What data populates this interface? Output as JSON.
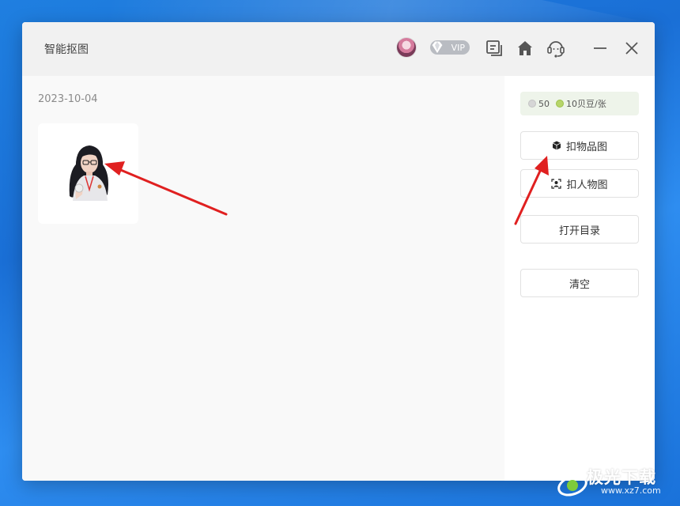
{
  "window": {
    "title": "智能抠图"
  },
  "titlebar": {
    "vip_label": "VIP",
    "icons": [
      "avatar",
      "vip-gem-icon",
      "message-icon",
      "home-icon",
      "headset-icon",
      "minimize-icon",
      "close-icon"
    ]
  },
  "main": {
    "date": "2023-10-04",
    "thumbnail": "cutout-person-image"
  },
  "sidebar": {
    "credits_count": "50",
    "price_text": "10贝豆/张",
    "buttons": {
      "cutout_product": "扣物品图",
      "cutout_person": "扣人物图",
      "open_dir": "打开目录",
      "clear": "清空"
    }
  },
  "colors": {
    "desktop_blue": "#1a6fd6",
    "accent_green": "#b7d56a",
    "arrow_red": "#e02020"
  },
  "watermark": {
    "brand": "极光下载",
    "url": "www.xz7.com"
  }
}
